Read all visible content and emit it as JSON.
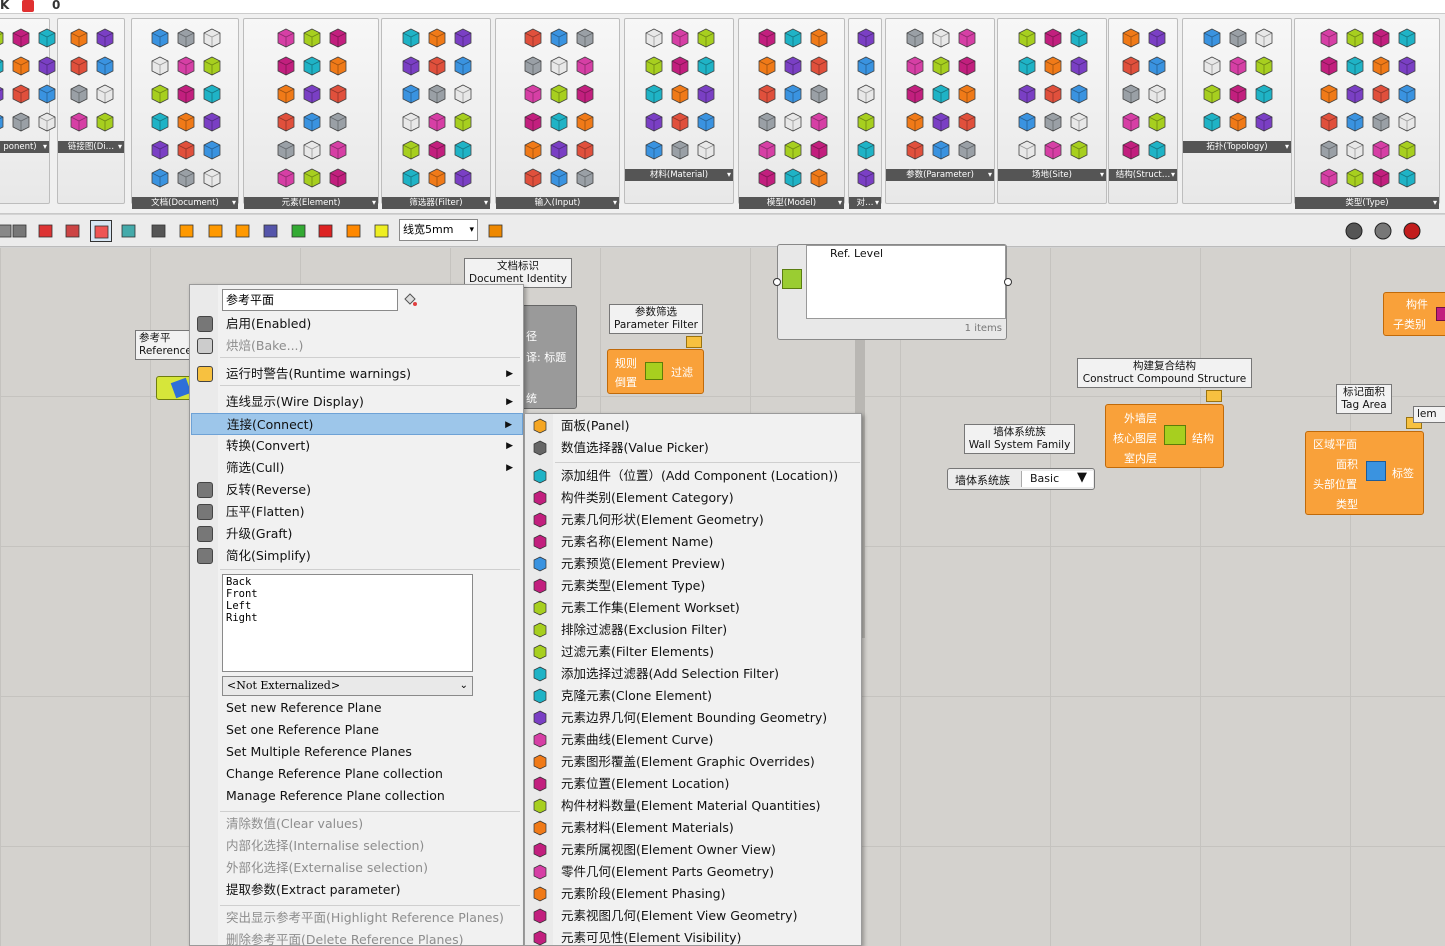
{
  "ribbon": {
    "groups": [
      {
        "label": "ponent)",
        "id": "component"
      },
      {
        "label": "链接图(Di…",
        "id": "links"
      },
      {
        "label": "文档(Document)",
        "id": "document"
      },
      {
        "label": "元素(Element)",
        "id": "element"
      },
      {
        "label": "筛选器(Filter)",
        "id": "filter"
      },
      {
        "label": "输入(Input)",
        "id": "input"
      },
      {
        "label": "材料(Material)",
        "id": "material"
      },
      {
        "label": "模型(Model)",
        "id": "model"
      },
      {
        "label": "对…",
        "id": "object"
      },
      {
        "label": "参数(Parameter)",
        "id": "parameter"
      },
      {
        "label": "场地(Site)",
        "id": "site"
      },
      {
        "label": "结构(Struct…",
        "id": "structure"
      },
      {
        "label": "拓扑(Topology)",
        "id": "topology"
      },
      {
        "label": "类型(Type)",
        "id": "type"
      }
    ]
  },
  "toolbar": {
    "line_width": "线宽5mm"
  },
  "canvas": {
    "ref_level": "Ref. Level",
    "items_count": "1 items",
    "doc_identity": {
      "cn": "文档标识",
      "en": "Document Identity"
    },
    "doc_identity_outputs": [
      "径",
      "译: 标题",
      "统"
    ],
    "param_filter": {
      "cn": "参数筛选",
      "en": "Parameter Filter",
      "in1": "规则",
      "in2": "倒置",
      "out": "过滤"
    },
    "ref_plane_node": {
      "cn": "参考平",
      "en": "Reference"
    },
    "compound": {
      "cn": "构建复合结构",
      "en": "Construct Compound Structure",
      "in1": "外墙层",
      "in2": "核心图层",
      "in3": "室内层",
      "out": "结构"
    },
    "wall_family": {
      "cn": "墙体系统族",
      "en": "Wall System Family",
      "picker_label": "墙体系统族",
      "picker_value": "Basic"
    },
    "tag_area": {
      "cn": "标记面积",
      "en": "Tag Area",
      "in1": "区域平面",
      "in2": "面积",
      "in3": "头部位置",
      "in4": "类型",
      "out": "标签"
    },
    "component_right": {
      "in1": "构件",
      "in2": "子类别"
    },
    "elem_partial": "lem"
  },
  "context_menu": {
    "name_value": "参考平面",
    "items": [
      {
        "label": "启用(Enabled)",
        "disabled": false,
        "sub": false
      },
      {
        "label": "烘焙(Bake...)",
        "disabled": true,
        "sub": false
      },
      {
        "label": "运行时警告(Runtime warnings)",
        "disabled": false,
        "sub": true
      },
      {
        "label": "连线显示(Wire Display)",
        "disabled": false,
        "sub": true
      },
      {
        "label": "连接(Connect)",
        "disabled": false,
        "sub": true
      },
      {
        "label": "转换(Convert)",
        "disabled": false,
        "sub": true
      },
      {
        "label": "筛选(Cull)",
        "disabled": false,
        "sub": true
      },
      {
        "label": "反转(Reverse)",
        "disabled": false,
        "sub": false
      },
      {
        "label": "压平(Flatten)",
        "disabled": false,
        "sub": false
      },
      {
        "label": "升级(Graft)",
        "disabled": false,
        "sub": false
      },
      {
        "label": "简化(Simplify)",
        "disabled": false,
        "sub": false
      }
    ],
    "list_values": [
      "Back",
      "Front",
      "Left",
      "Right"
    ],
    "externalized": "<Not Externalized>",
    "actions": [
      "Set new Reference Plane",
      "Set one Reference Plane",
      "Set Multiple Reference Planes",
      "Change Reference Plane collection",
      "Manage Reference Plane collection"
    ],
    "data_items": [
      {
        "label": "清除数值(Clear values)",
        "disabled": true
      },
      {
        "label": "内部化选择(Internalise selection)",
        "disabled": true
      },
      {
        "label": "外部化选择(Externalise selection)",
        "disabled": true
      },
      {
        "label": "提取参数(Extract parameter)",
        "disabled": false
      }
    ],
    "extra_items": [
      {
        "label": "突出显示参考平面(Highlight Reference Planes)",
        "disabled": true
      },
      {
        "label": "删除参考平面(Delete Reference Planes)",
        "disabled": true
      }
    ]
  },
  "connect_submenu": {
    "items": [
      "面板(Panel)",
      "数值选择器(Value Picker)",
      "添加组件（位置）(Add Component (Location))",
      "构件类别(Element Category)",
      "元素几何形状(Element Geometry)",
      "元素名称(Element Name)",
      "元素预览(Element Preview)",
      "元素类型(Element Type)",
      "元素工作集(Element Workset)",
      "排除过滤器(Exclusion Filter)",
      "过滤元素(Filter Elements)",
      "添加选择过滤器(Add Selection Filter)",
      "克隆元素(Clone Element)",
      "元素边界几何(Element Bounding Geometry)",
      "元素曲线(Element Curve)",
      "元素图形覆盖(Element Graphic Overrides)",
      "元素位置(Element Location)",
      "构件材料数量(Element Material Quantities)",
      "元素材料(Element Materials)",
      "元素所属视图(Element Owner View)",
      "零件几何(Element Parts Geometry)",
      "元素阶段(Element Phasing)",
      "元素视图几何(Element View Geometry)",
      "元素可见性(Element Visibility)"
    ]
  },
  "colors": {
    "accent_orange": "#f9a13a",
    "highlight": "#9dc6ea",
    "ribbon_label_bg": "#555555",
    "lime": "#a7cf1f"
  }
}
